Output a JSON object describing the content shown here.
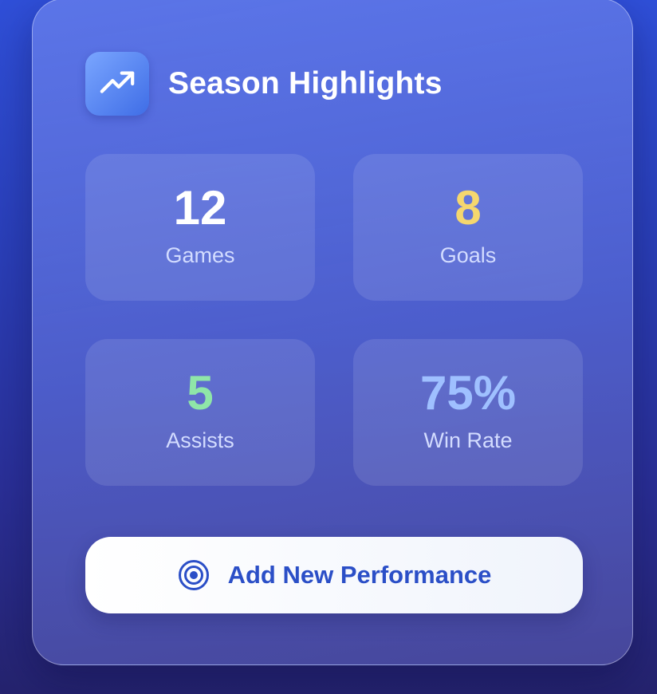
{
  "card": {
    "title": "Season Highlights",
    "header_icon": "trending-up-icon"
  },
  "stats": [
    {
      "value": "12",
      "label": "Games",
      "color": "#ffffff"
    },
    {
      "value": "8",
      "label": "Goals",
      "color": "#f5d76e"
    },
    {
      "value": "5",
      "label": "Assists",
      "color": "#8fe6a8"
    },
    {
      "value": "75%",
      "label": "Win Rate",
      "color": "#9fc0ff"
    }
  ],
  "action": {
    "label": "Add New Performance",
    "icon": "target-icon"
  },
  "colors": {
    "accent": "#2b4fc7",
    "goals": "#f5d76e",
    "assists": "#8fe6a8",
    "win_rate": "#9fc0ff"
  }
}
